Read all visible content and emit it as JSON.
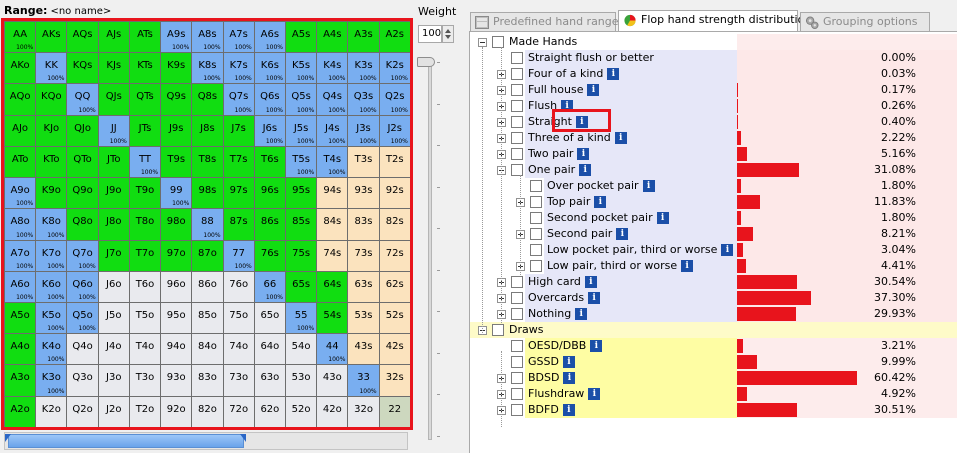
{
  "range": {
    "label": "Range:",
    "name": "<no name>",
    "grid": [
      [
        [
          "AA",
          "g",
          "100%"
        ],
        [
          "AKs",
          "g",
          ""
        ],
        [
          "AQs",
          "g",
          ""
        ],
        [
          "AJs",
          "g",
          ""
        ],
        [
          "ATs",
          "g",
          ""
        ],
        [
          "A9s",
          "b",
          "100%"
        ],
        [
          "A8s",
          "b",
          "100%"
        ],
        [
          "A7s",
          "b",
          "100%"
        ],
        [
          "A6s",
          "b",
          "100%"
        ],
        [
          "A5s",
          "g",
          ""
        ],
        [
          "A4s",
          "g",
          ""
        ],
        [
          "A3s",
          "g",
          ""
        ],
        [
          "A2s",
          "g",
          ""
        ]
      ],
      [
        [
          "AKo",
          "g",
          ""
        ],
        [
          "KK",
          "b",
          "100%"
        ],
        [
          "KQs",
          "g",
          ""
        ],
        [
          "KJs",
          "g",
          ""
        ],
        [
          "KTs",
          "g",
          ""
        ],
        [
          "K9s",
          "g",
          ""
        ],
        [
          "K8s",
          "b",
          "100%"
        ],
        [
          "K7s",
          "b",
          "100%"
        ],
        [
          "K6s",
          "b",
          "100%"
        ],
        [
          "K5s",
          "b",
          "100%"
        ],
        [
          "K4s",
          "b",
          "100%"
        ],
        [
          "K3s",
          "b",
          "100%"
        ],
        [
          "K2s",
          "b",
          "100%"
        ]
      ],
      [
        [
          "AQo",
          "g",
          ""
        ],
        [
          "KQo",
          "g",
          ""
        ],
        [
          "QQ",
          "b",
          "100%"
        ],
        [
          "QJs",
          "g",
          ""
        ],
        [
          "QTs",
          "g",
          ""
        ],
        [
          "Q9s",
          "g",
          ""
        ],
        [
          "Q8s",
          "g",
          ""
        ],
        [
          "Q7s",
          "b",
          "100%"
        ],
        [
          "Q6s",
          "b",
          "100%"
        ],
        [
          "Q5s",
          "b",
          "100%"
        ],
        [
          "Q4s",
          "b",
          "100%"
        ],
        [
          "Q3s",
          "b",
          "100%"
        ],
        [
          "Q2s",
          "b",
          "100%"
        ]
      ],
      [
        [
          "AJo",
          "g",
          ""
        ],
        [
          "KJo",
          "g",
          ""
        ],
        [
          "QJo",
          "g",
          ""
        ],
        [
          "JJ",
          "b",
          "100%"
        ],
        [
          "JTs",
          "g",
          ""
        ],
        [
          "J9s",
          "g",
          ""
        ],
        [
          "J8s",
          "g",
          ""
        ],
        [
          "J7s",
          "g",
          ""
        ],
        [
          "J6s",
          "b",
          "100%"
        ],
        [
          "J5s",
          "b",
          "100%"
        ],
        [
          "J4s",
          "b",
          "100%"
        ],
        [
          "J3s",
          "b",
          "100%"
        ],
        [
          "J2s",
          "b",
          "100%"
        ]
      ],
      [
        [
          "ATo",
          "g",
          ""
        ],
        [
          "KTo",
          "g",
          ""
        ],
        [
          "QTo",
          "g",
          ""
        ],
        [
          "JTo",
          "g",
          ""
        ],
        [
          "TT",
          "b",
          "100%"
        ],
        [
          "T9s",
          "g",
          ""
        ],
        [
          "T8s",
          "g",
          ""
        ],
        [
          "T7s",
          "g",
          ""
        ],
        [
          "T6s",
          "g",
          ""
        ],
        [
          "T5s",
          "b",
          "100%"
        ],
        [
          "T4s",
          "b",
          "100%"
        ],
        [
          "T3s",
          "t",
          ""
        ],
        [
          "T2s",
          "t",
          ""
        ]
      ],
      [
        [
          "A9o",
          "b",
          "100%"
        ],
        [
          "K9o",
          "g",
          ""
        ],
        [
          "Q9o",
          "g",
          ""
        ],
        [
          "J9o",
          "g",
          ""
        ],
        [
          "T9o",
          "g",
          ""
        ],
        [
          "99",
          "b",
          "100%"
        ],
        [
          "98s",
          "g",
          ""
        ],
        [
          "97s",
          "g",
          ""
        ],
        [
          "96s",
          "g",
          ""
        ],
        [
          "95s",
          "g",
          ""
        ],
        [
          "94s",
          "t",
          ""
        ],
        [
          "93s",
          "t",
          ""
        ],
        [
          "92s",
          "t",
          ""
        ]
      ],
      [
        [
          "A8o",
          "b",
          "100%"
        ],
        [
          "K8o",
          "b",
          "100%"
        ],
        [
          "Q8o",
          "g",
          ""
        ],
        [
          "J8o",
          "g",
          ""
        ],
        [
          "T8o",
          "g",
          ""
        ],
        [
          "98o",
          "g",
          ""
        ],
        [
          "88",
          "b",
          "100%"
        ],
        [
          "87s",
          "g",
          ""
        ],
        [
          "86s",
          "g",
          ""
        ],
        [
          "85s",
          "g",
          ""
        ],
        [
          "84s",
          "t",
          ""
        ],
        [
          "83s",
          "t",
          ""
        ],
        [
          "82s",
          "t",
          ""
        ]
      ],
      [
        [
          "A7o",
          "b",
          "100%"
        ],
        [
          "K7o",
          "b",
          "100%"
        ],
        [
          "Q7o",
          "b",
          "100%"
        ],
        [
          "J7o",
          "g",
          ""
        ],
        [
          "T7o",
          "g",
          ""
        ],
        [
          "97o",
          "g",
          ""
        ],
        [
          "87o",
          "g",
          ""
        ],
        [
          "77",
          "b",
          "100%"
        ],
        [
          "76s",
          "g",
          ""
        ],
        [
          "75s",
          "g",
          ""
        ],
        [
          "74s",
          "t",
          ""
        ],
        [
          "73s",
          "t",
          ""
        ],
        [
          "72s",
          "t",
          ""
        ]
      ],
      [
        [
          "A6o",
          "b",
          "100%"
        ],
        [
          "K6o",
          "b",
          "100%"
        ],
        [
          "Q6o",
          "b",
          "100%"
        ],
        [
          "J6o",
          "w",
          ""
        ],
        [
          "T6o",
          "w",
          ""
        ],
        [
          "96o",
          "w",
          ""
        ],
        [
          "86o",
          "w",
          ""
        ],
        [
          "76o",
          "w",
          ""
        ],
        [
          "66",
          "b",
          "100%"
        ],
        [
          "65s",
          "g",
          ""
        ],
        [
          "64s",
          "g",
          ""
        ],
        [
          "63s",
          "t",
          ""
        ],
        [
          "62s",
          "t",
          ""
        ]
      ],
      [
        [
          "A5o",
          "g",
          ""
        ],
        [
          "K5o",
          "b",
          "100%"
        ],
        [
          "Q5o",
          "b",
          "100%"
        ],
        [
          "J5o",
          "w",
          ""
        ],
        [
          "T5o",
          "w",
          ""
        ],
        [
          "95o",
          "w",
          ""
        ],
        [
          "85o",
          "w",
          ""
        ],
        [
          "75o",
          "w",
          ""
        ],
        [
          "65o",
          "w",
          ""
        ],
        [
          "55",
          "b",
          "100%"
        ],
        [
          "54s",
          "g",
          ""
        ],
        [
          "53s",
          "t",
          ""
        ],
        [
          "52s",
          "t",
          ""
        ]
      ],
      [
        [
          "A4o",
          "g",
          ""
        ],
        [
          "K4o",
          "b",
          "100%"
        ],
        [
          "Q4o",
          "w",
          ""
        ],
        [
          "J4o",
          "w",
          ""
        ],
        [
          "T4o",
          "w",
          ""
        ],
        [
          "94o",
          "w",
          ""
        ],
        [
          "84o",
          "w",
          ""
        ],
        [
          "74o",
          "w",
          ""
        ],
        [
          "64o",
          "w",
          ""
        ],
        [
          "54o",
          "w",
          ""
        ],
        [
          "44",
          "b",
          "100%"
        ],
        [
          "43s",
          "t",
          ""
        ],
        [
          "42s",
          "t",
          ""
        ]
      ],
      [
        [
          "A3o",
          "g",
          ""
        ],
        [
          "K3o",
          "b",
          "100%"
        ],
        [
          "Q3o",
          "w",
          ""
        ],
        [
          "J3o",
          "w",
          ""
        ],
        [
          "T3o",
          "w",
          ""
        ],
        [
          "93o",
          "w",
          ""
        ],
        [
          "83o",
          "w",
          ""
        ],
        [
          "73o",
          "w",
          ""
        ],
        [
          "63o",
          "w",
          ""
        ],
        [
          "53o",
          "w",
          ""
        ],
        [
          "43o",
          "w",
          ""
        ],
        [
          "33",
          "b",
          "100%"
        ],
        [
          "32s",
          "t",
          ""
        ]
      ],
      [
        [
          "A2o",
          "g",
          ""
        ],
        [
          "K2o",
          "w",
          ""
        ],
        [
          "Q2o",
          "w",
          ""
        ],
        [
          "J2o",
          "w",
          ""
        ],
        [
          "T2o",
          "w",
          ""
        ],
        [
          "92o",
          "w",
          ""
        ],
        [
          "82o",
          "w",
          ""
        ],
        [
          "72o",
          "w",
          ""
        ],
        [
          "62o",
          "w",
          ""
        ],
        [
          "52o",
          "w",
          ""
        ],
        [
          "42o",
          "w",
          ""
        ],
        [
          "32o",
          "w",
          ""
        ],
        [
          "22",
          "p",
          ""
        ]
      ]
    ]
  },
  "weight": {
    "label": "Weight",
    "value": "100",
    "level_percent": 100
  },
  "tabs": [
    {
      "label": "Predefined hand ranges",
      "icon": "table-icon",
      "active": false
    },
    {
      "label": "Flop hand strength distribution",
      "icon": "pie-chart-icon",
      "active": true
    },
    {
      "label": "Grouping options",
      "icon": "gears-icon",
      "active": false
    }
  ],
  "tree": [
    {
      "label": "Made Hands",
      "level": 0,
      "expander": "minus",
      "group": "made-hdr",
      "info": false,
      "pct": null
    },
    {
      "label": "Straight flush or better",
      "level": 1,
      "expander": "none",
      "group": "made",
      "info": false,
      "pct": 0.0,
      "text": "0.00%"
    },
    {
      "label": "Four of a kind",
      "level": 1,
      "expander": "plus",
      "group": "made",
      "info": true,
      "pct": 0.03,
      "text": "0.03%"
    },
    {
      "label": "Full house",
      "level": 1,
      "expander": "plus",
      "group": "made",
      "info": true,
      "pct": 0.17,
      "text": "0.17%"
    },
    {
      "label": "Flush",
      "level": 1,
      "expander": "plus",
      "group": "made",
      "info": true,
      "pct": 0.26,
      "text": "0.26%"
    },
    {
      "label": "Straight",
      "level": 1,
      "expander": "plus",
      "group": "made",
      "info": true,
      "pct": 0.4,
      "text": "0.40%"
    },
    {
      "label": "Three of a kind",
      "level": 1,
      "expander": "plus",
      "group": "made",
      "info": true,
      "pct": 2.22,
      "text": "2.22%"
    },
    {
      "label": "Two pair",
      "level": 1,
      "expander": "plus",
      "group": "made",
      "info": true,
      "pct": 5.16,
      "text": "5.16%"
    },
    {
      "label": "One pair",
      "level": 1,
      "expander": "minus",
      "group": "made",
      "info": true,
      "pct": 31.08,
      "text": "31.08%"
    },
    {
      "label": "Over pocket pair",
      "level": 2,
      "expander": "none",
      "group": "made",
      "info": true,
      "pct": 1.8,
      "text": "1.80%"
    },
    {
      "label": "Top pair",
      "level": 2,
      "expander": "plus",
      "group": "made",
      "info": true,
      "pct": 11.83,
      "text": "11.83%"
    },
    {
      "label": "Second pocket pair",
      "level": 2,
      "expander": "none",
      "group": "made",
      "info": true,
      "pct": 1.8,
      "text": "1.80%"
    },
    {
      "label": "Second pair",
      "level": 2,
      "expander": "plus",
      "group": "made",
      "info": true,
      "pct": 8.21,
      "text": "8.21%"
    },
    {
      "label": "Low pocket pair, third or worse",
      "level": 2,
      "expander": "none",
      "group": "made",
      "info": true,
      "pct": 3.04,
      "text": "3.04%"
    },
    {
      "label": "Low pair, third or worse",
      "level": 2,
      "expander": "plus",
      "group": "made",
      "info": true,
      "pct": 4.41,
      "text": "4.41%"
    },
    {
      "label": "High card",
      "level": 1,
      "expander": "plus",
      "group": "made",
      "info": true,
      "pct": 30.54,
      "text": "30.54%"
    },
    {
      "label": "Overcards",
      "level": 1,
      "expander": "plus",
      "group": "made",
      "info": true,
      "pct": 37.3,
      "text": "37.30%"
    },
    {
      "label": "Nothing",
      "level": 1,
      "expander": "plus",
      "group": "made",
      "info": true,
      "pct": 29.93,
      "text": "29.93%"
    },
    {
      "label": "Draws",
      "level": 0,
      "expander": "minus",
      "group": "draw-hdr",
      "info": false,
      "pct": null
    },
    {
      "label": "OESD/DBB",
      "level": 1,
      "expander": "none",
      "group": "draw",
      "info": true,
      "pct": 3.21,
      "text": "3.21%"
    },
    {
      "label": "GSSD",
      "level": 1,
      "expander": "none",
      "group": "draw",
      "info": true,
      "pct": 9.99,
      "text": "9.99%"
    },
    {
      "label": "BDSD",
      "level": 1,
      "expander": "plus",
      "group": "draw",
      "info": true,
      "pct": 60.42,
      "text": "60.42%"
    },
    {
      "label": "Flushdraw",
      "level": 1,
      "expander": "plus",
      "group": "draw",
      "info": true,
      "pct": 4.92,
      "text": "4.92%"
    },
    {
      "label": "BDFD",
      "level": 1,
      "expander": "plus",
      "group": "draw",
      "info": true,
      "pct": 30.51,
      "text": "30.51%"
    }
  ],
  "colors": {
    "green": "#11dd11",
    "blue": "#79aef0",
    "tan": "#fbe3be",
    "white": "#e9eaee",
    "bar": "#e8141c",
    "highlight": "#e8141c"
  }
}
